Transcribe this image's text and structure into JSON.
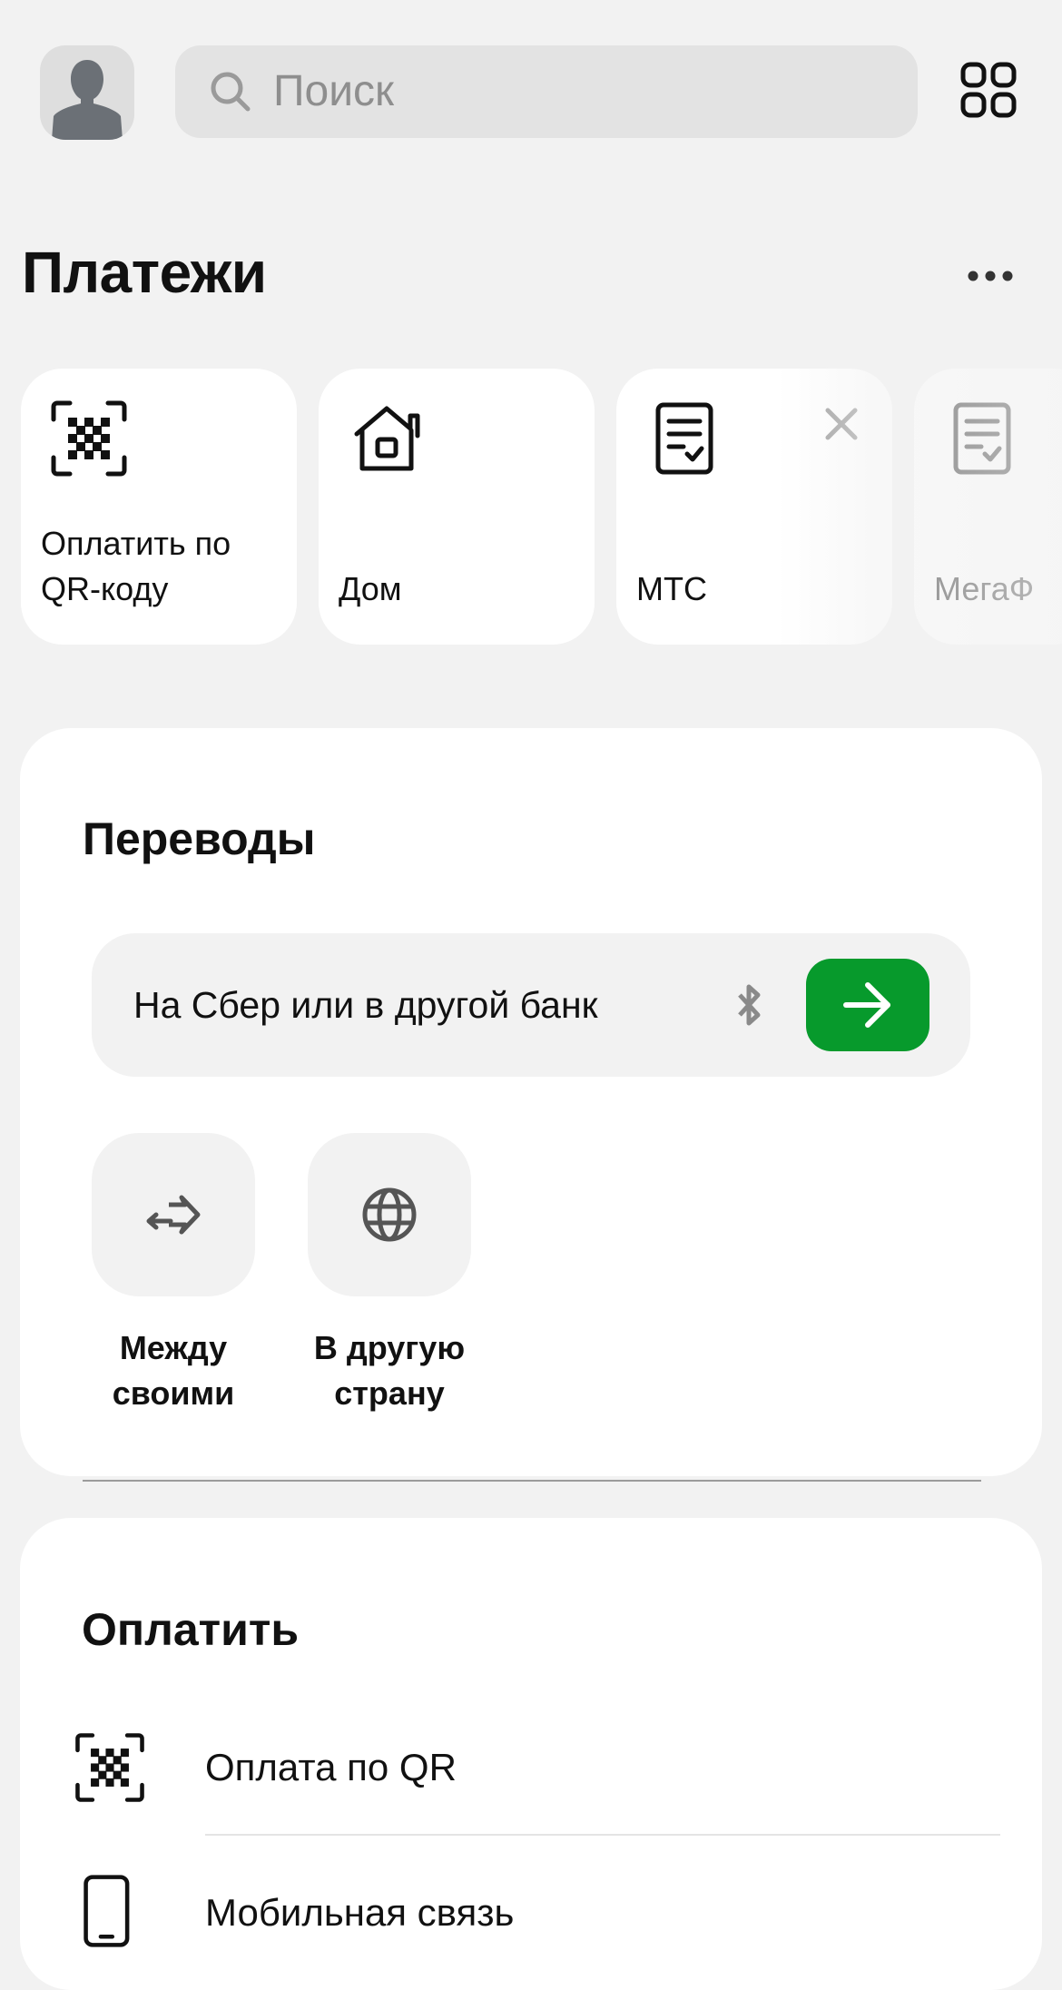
{
  "header": {
    "search_placeholder": "Поиск"
  },
  "payments": {
    "title": "Платежи",
    "tiles": [
      {
        "label_line1": "Оплатить по",
        "label_line2": "QR-коду",
        "icon": "qr-scan-icon"
      },
      {
        "label_line1": "",
        "label_line2": "Дом",
        "icon": "home-icon"
      },
      {
        "label_line1": "",
        "label_line2": "МТС",
        "icon": "receipt-icon"
      },
      {
        "label_line1": "",
        "label_line2": "МегаФ",
        "icon": "receipt-icon"
      }
    ]
  },
  "transfers": {
    "title": "Переводы",
    "field_text": "На Сбер или в другой банк",
    "buttons": [
      {
        "line1": "Между",
        "line2": "своими",
        "icon": "exchange-arrows-icon"
      },
      {
        "line1": "В другую",
        "line2": "страну",
        "icon": "globe-icon"
      }
    ]
  },
  "pay": {
    "title": "Оплатить",
    "rows": [
      {
        "label": "Оплата по QR",
        "icon": "qr-scan-icon"
      },
      {
        "label": "Мобильная связь",
        "icon": "phone-icon"
      }
    ]
  },
  "colors": {
    "accent_green": "#079a2c",
    "background": "#f2f2f2",
    "card": "#ffffff"
  }
}
